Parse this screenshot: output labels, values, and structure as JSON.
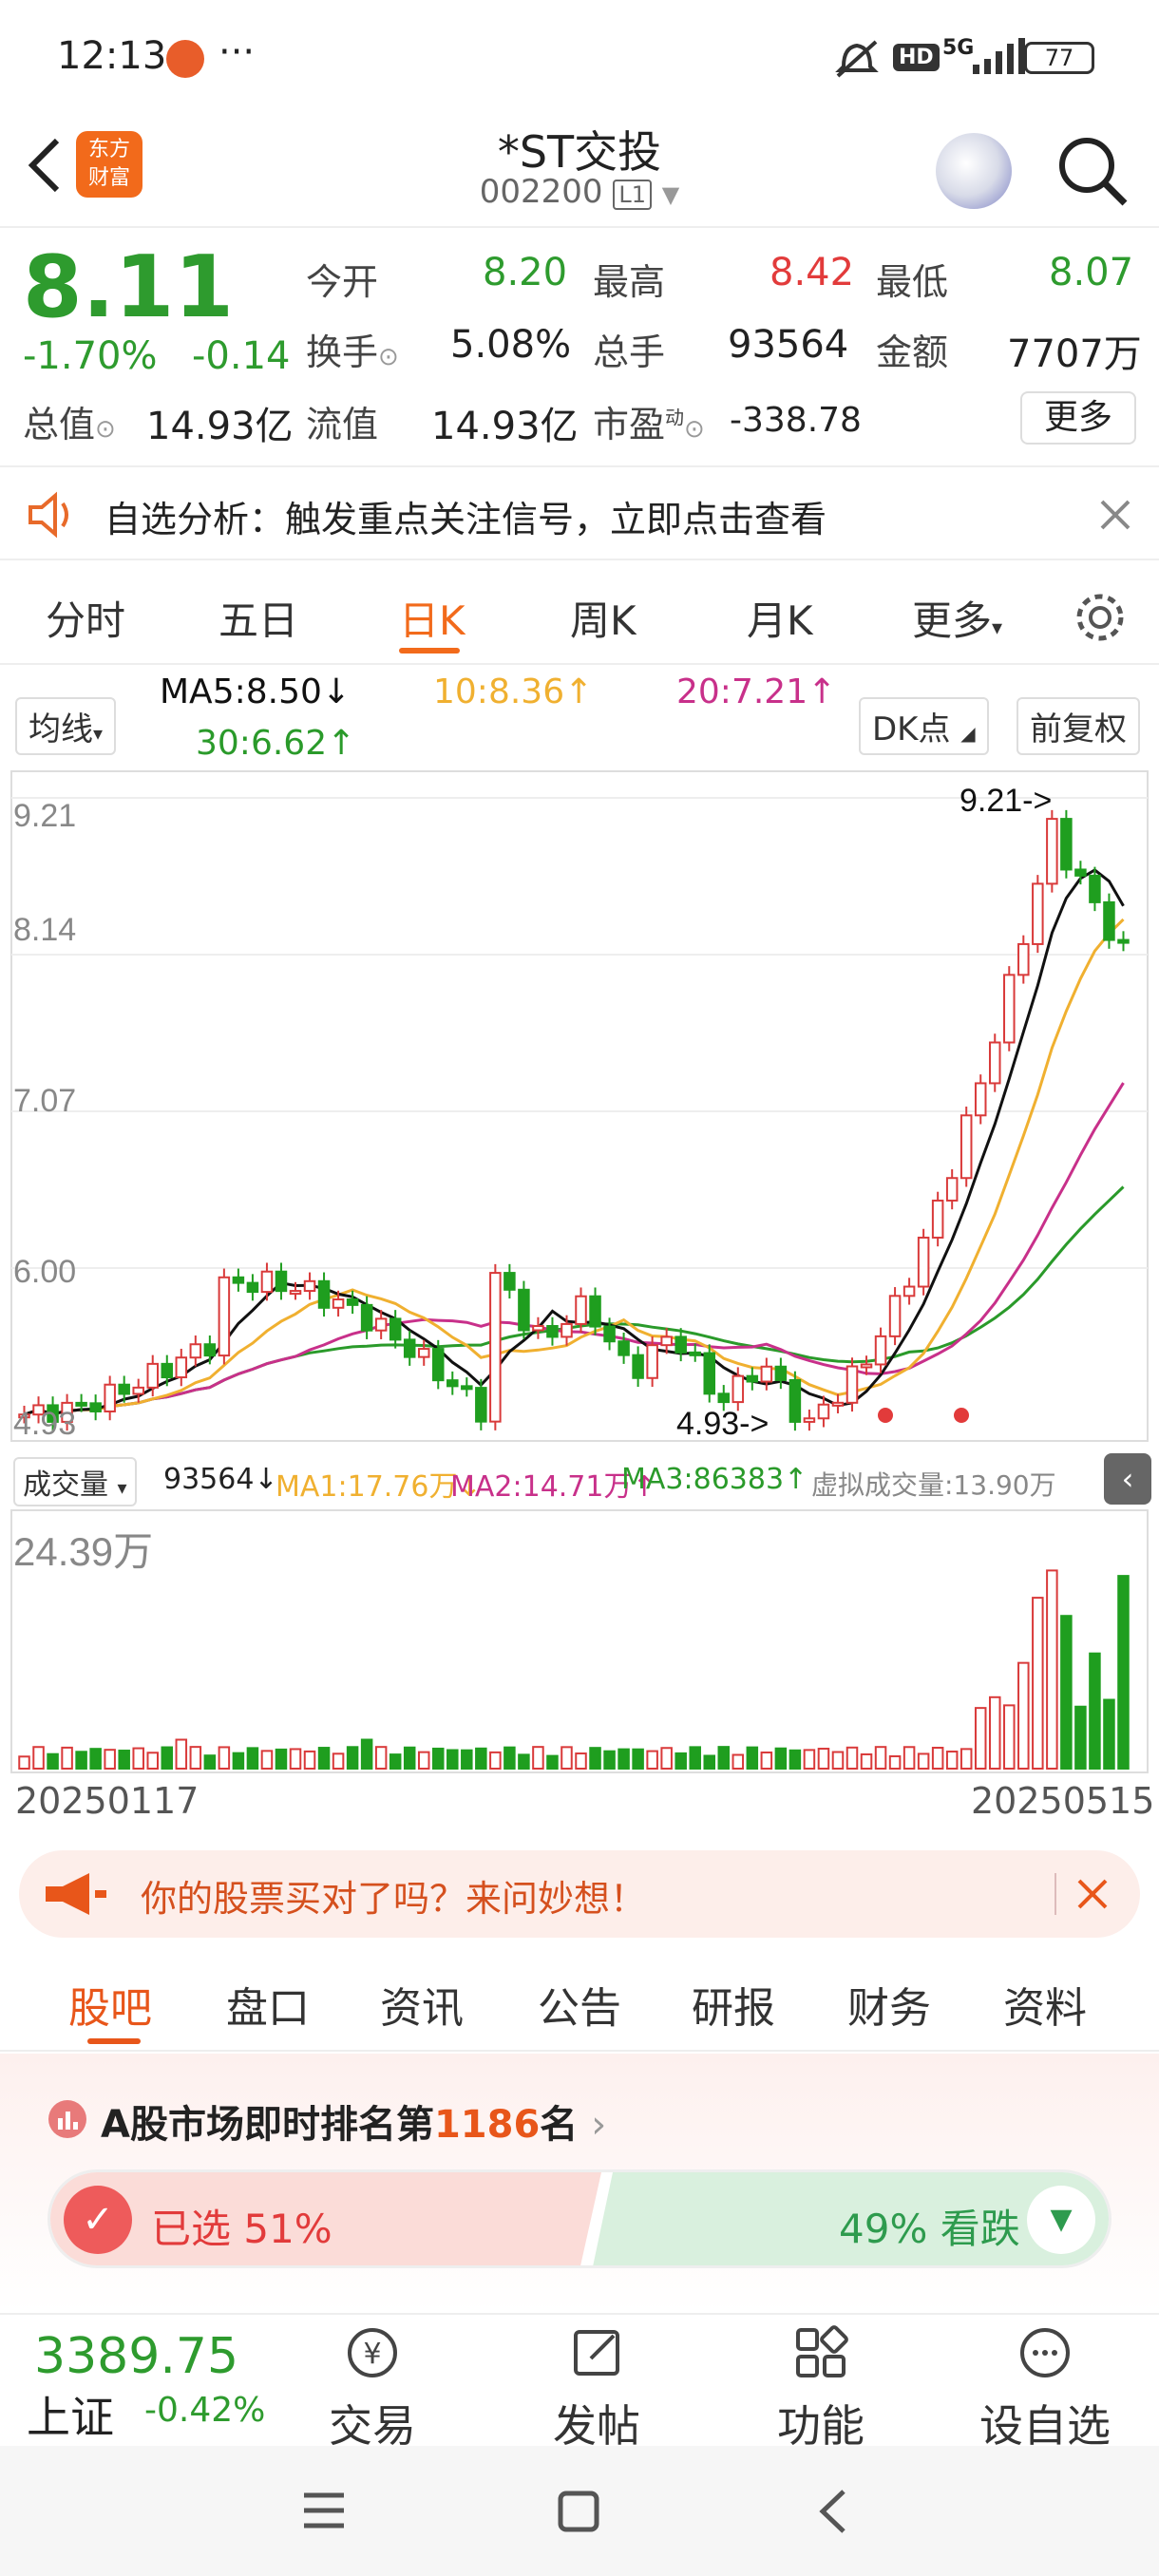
{
  "status": {
    "time": "12:13",
    "more": "···",
    "hd": "HD",
    "net": "5G",
    "battery": "77"
  },
  "header": {
    "logo_line1": "东方",
    "logo_line2": "财富",
    "title": "*ST交投",
    "code": "002200",
    "level": "L1"
  },
  "quote": {
    "price": "8.11",
    "change_pct": "-1.70%",
    "change": "-0.14",
    "open_label": "今开",
    "open": "8.20",
    "high_label": "最高",
    "high": "8.42",
    "low_label": "最低",
    "low": "8.07",
    "turnover_label": "换手",
    "turnover": "5.08%",
    "volume_label": "总手",
    "volume": "93564",
    "amount_label": "金额",
    "amount": "7707万",
    "mktcap_label": "总值",
    "mktcap": "14.93亿",
    "float_label": "流值",
    "float": "14.93亿",
    "pe_label": "市盈",
    "pe_sup": "动",
    "pe": "-338.78",
    "more_btn": "更多"
  },
  "banner1": {
    "text": "自选分析：触发重点关注信号，立即点击查看"
  },
  "period_tabs": [
    "分时",
    "五日",
    "日K",
    "周K",
    "月K",
    "更多"
  ],
  "active_period": 2,
  "ma_row": {
    "selector": "均线",
    "ma5": "MA5:8.50↓",
    "ma10": "10:8.36↑",
    "ma20": "20:7.21↑",
    "ma30": "30:6.62↑",
    "dk": "DK点",
    "adjust": "前复权"
  },
  "chart_data": {
    "type": "candlestick",
    "y_ticks": [
      "9.21",
      "8.14",
      "7.07",
      "6.00",
      "4.93"
    ],
    "ylim": [
      4.93,
      9.21
    ],
    "high_annotation": "9.21->",
    "low_annotation": "4.93->",
    "start_date": "20250117",
    "end_date": "20250515",
    "colors": {
      "up": "#d93a3a",
      "down": "#1f9e1f",
      "ma5": "#111111",
      "ma10": "#f0b030",
      "ma20": "#c8308a",
      "ma30": "#2a9a2a"
    },
    "volume": {
      "selector": "成交量",
      "current": "93564↓",
      "ma1": "MA1:17.76万↓",
      "ma2": "MA2:14.71万↑",
      "ma3": "MA3:86383↑",
      "virtual": "虚拟成交量:13.90万",
      "ymax_label": "24.39万"
    }
  },
  "banner2": {
    "text": "你的股票买对了吗？来问妙想！"
  },
  "sub_tabs": [
    "股吧",
    "盘口",
    "资讯",
    "公告",
    "研报",
    "财务",
    "资料"
  ],
  "active_sub": 0,
  "ranking": {
    "prefix": "A股市场即时排名第",
    "rank": "1186",
    "suffix": "名"
  },
  "vote": {
    "up_label": "已选 51%",
    "down_label": "49% 看跌",
    "up_pct": 51
  },
  "index": {
    "value": "3389.75",
    "name": "上证",
    "change": "-0.42%"
  },
  "bottom_nav": [
    "交易",
    "发帖",
    "功能",
    "设自选"
  ]
}
